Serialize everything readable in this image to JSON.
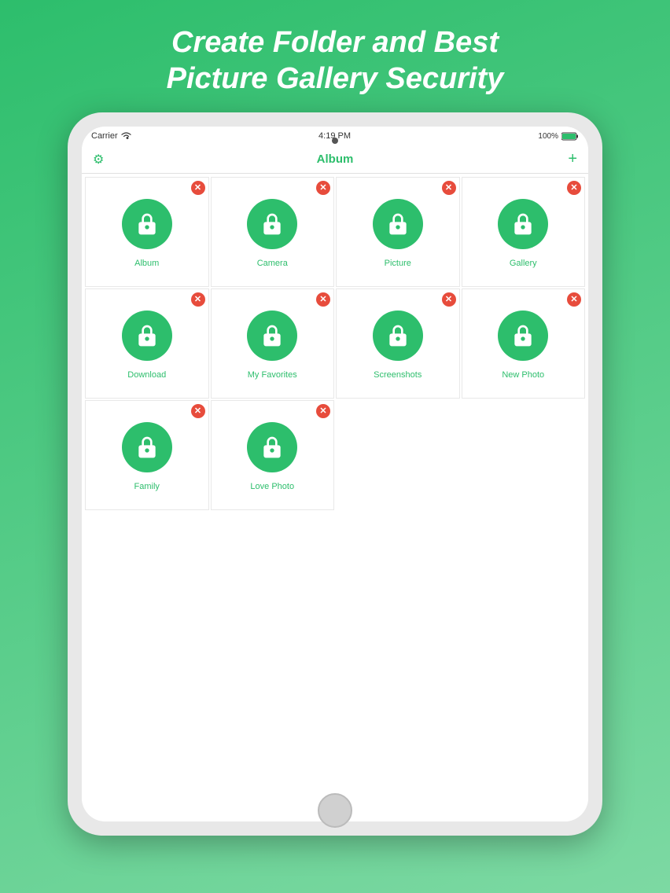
{
  "headline": {
    "line1": "Create Folder and Best",
    "line2": "Picture Gallery Security"
  },
  "statusBar": {
    "carrier": "Carrier",
    "wifi": "WiFi",
    "time": "4:19 PM",
    "battery": "100%"
  },
  "navBar": {
    "title": "Album",
    "leftIcon": "gear",
    "rightIcon": "+"
  },
  "folders": [
    {
      "id": 1,
      "label": "Album",
      "hasDel": true
    },
    {
      "id": 2,
      "label": "Camera",
      "hasDel": true
    },
    {
      "id": 3,
      "label": "Picture",
      "hasDel": true
    },
    {
      "id": 4,
      "label": "Gallery",
      "hasDel": true
    },
    {
      "id": 5,
      "label": "Download",
      "hasDel": true
    },
    {
      "id": 6,
      "label": "My Favorites",
      "hasDel": true
    },
    {
      "id": 7,
      "label": "Screenshots",
      "hasDel": true
    },
    {
      "id": 8,
      "label": "New Photo",
      "hasDel": true
    },
    {
      "id": 9,
      "label": "Family",
      "hasDel": true
    },
    {
      "id": 10,
      "label": "Love Photo",
      "hasDel": true
    }
  ],
  "colors": {
    "green": "#2dbe6c",
    "red": "#e74c3c"
  }
}
